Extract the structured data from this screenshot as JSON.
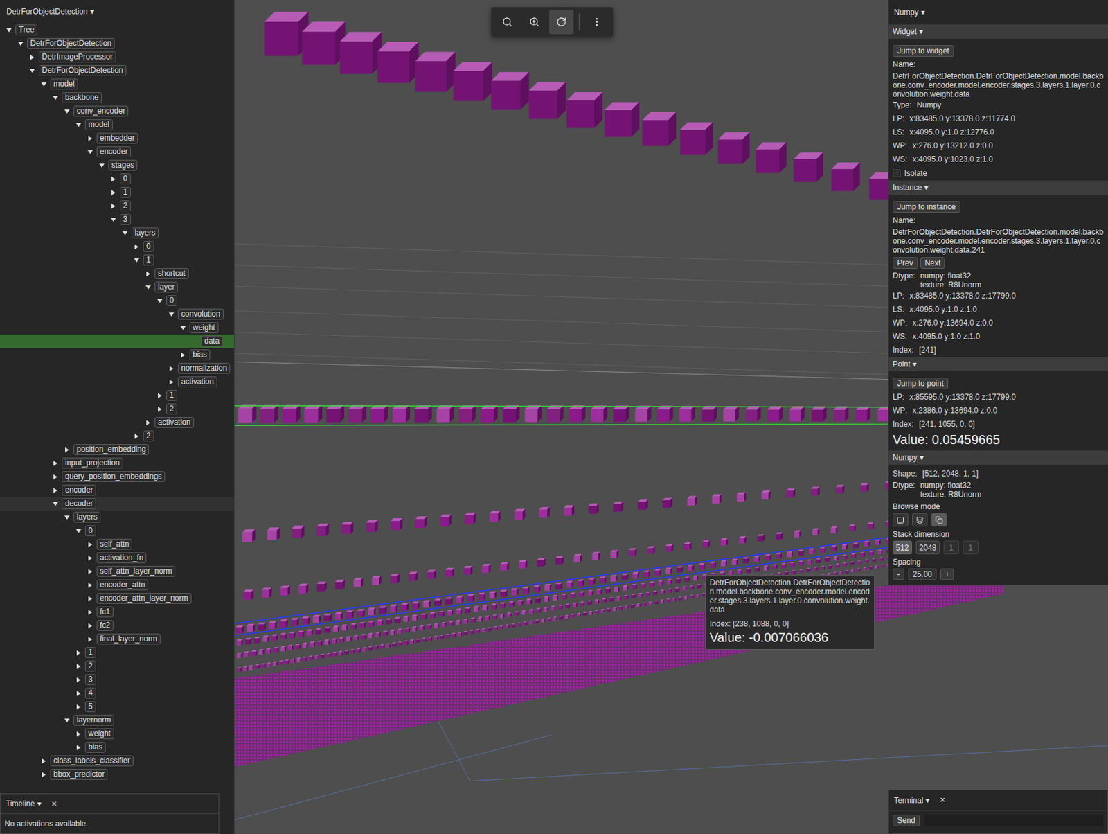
{
  "tree_panel": {
    "title": "DetrForObjectDetection",
    "glyph": "▾"
  },
  "tree": [
    {
      "label": "Tree",
      "depth": 0,
      "expanded": true,
      "leaf": false,
      "selected": false,
      "hovered": false
    },
    {
      "label": "DetrForObjectDetection",
      "depth": 1,
      "expanded": true,
      "leaf": false,
      "selected": false,
      "hovered": false
    },
    {
      "label": "DetrImageProcessor",
      "depth": 2,
      "expanded": false,
      "leaf": false,
      "selected": false,
      "hovered": false
    },
    {
      "label": "DetrForObjectDetection",
      "depth": 2,
      "expanded": true,
      "leaf": false,
      "selected": false,
      "hovered": false
    },
    {
      "label": "model",
      "depth": 3,
      "expanded": true,
      "leaf": false,
      "selected": false,
      "hovered": false
    },
    {
      "label": "backbone",
      "depth": 4,
      "expanded": true,
      "leaf": false,
      "selected": false,
      "hovered": false
    },
    {
      "label": "conv_encoder",
      "depth": 5,
      "expanded": true,
      "leaf": false,
      "selected": false,
      "hovered": false
    },
    {
      "label": "model",
      "depth": 6,
      "expanded": true,
      "leaf": false,
      "selected": false,
      "hovered": false
    },
    {
      "label": "embedder",
      "depth": 7,
      "expanded": false,
      "leaf": false,
      "selected": false,
      "hovered": false
    },
    {
      "label": "encoder",
      "depth": 7,
      "expanded": true,
      "leaf": false,
      "selected": false,
      "hovered": false
    },
    {
      "label": "stages",
      "depth": 8,
      "expanded": true,
      "leaf": false,
      "selected": false,
      "hovered": false
    },
    {
      "label": "0",
      "depth": 9,
      "expanded": false,
      "leaf": false,
      "selected": false,
      "hovered": false
    },
    {
      "label": "1",
      "depth": 9,
      "expanded": false,
      "leaf": false,
      "selected": false,
      "hovered": false
    },
    {
      "label": "2",
      "depth": 9,
      "expanded": false,
      "leaf": false,
      "selected": false,
      "hovered": false
    },
    {
      "label": "3",
      "depth": 9,
      "expanded": true,
      "leaf": false,
      "selected": false,
      "hovered": false
    },
    {
      "label": "layers",
      "depth": 10,
      "expanded": true,
      "leaf": false,
      "selected": false,
      "hovered": false
    },
    {
      "label": "0",
      "depth": 11,
      "expanded": false,
      "leaf": false,
      "selected": false,
      "hovered": false
    },
    {
      "label": "1",
      "depth": 11,
      "expanded": true,
      "leaf": false,
      "selected": false,
      "hovered": false
    },
    {
      "label": "shortcut",
      "depth": 12,
      "expanded": false,
      "leaf": false,
      "selected": false,
      "hovered": false
    },
    {
      "label": "layer",
      "depth": 12,
      "expanded": true,
      "leaf": false,
      "selected": false,
      "hovered": false
    },
    {
      "label": "0",
      "depth": 13,
      "expanded": true,
      "leaf": false,
      "selected": false,
      "hovered": false
    },
    {
      "label": "convolution",
      "depth": 14,
      "expanded": true,
      "leaf": false,
      "selected": false,
      "hovered": false
    },
    {
      "label": "weight",
      "depth": 15,
      "expanded": true,
      "leaf": false,
      "selected": false,
      "hovered": false
    },
    {
      "label": "data",
      "depth": 16,
      "expanded": false,
      "leaf": true,
      "selected": true,
      "hovered": false
    },
    {
      "label": "bias",
      "depth": 15,
      "expanded": false,
      "leaf": false,
      "selected": false,
      "hovered": false
    },
    {
      "label": "normalization",
      "depth": 14,
      "expanded": false,
      "leaf": false,
      "selected": false,
      "hovered": false
    },
    {
      "label": "activation",
      "depth": 14,
      "expanded": false,
      "leaf": false,
      "selected": false,
      "hovered": false
    },
    {
      "label": "1",
      "depth": 13,
      "expanded": false,
      "leaf": false,
      "selected": false,
      "hovered": false
    },
    {
      "label": "2",
      "depth": 13,
      "expanded": false,
      "leaf": false,
      "selected": false,
      "hovered": false
    },
    {
      "label": "activation",
      "depth": 12,
      "expanded": false,
      "leaf": false,
      "selected": false,
      "hovered": false
    },
    {
      "label": "2",
      "depth": 11,
      "expanded": false,
      "leaf": false,
      "selected": false,
      "hovered": false
    },
    {
      "label": "position_embedding",
      "depth": 5,
      "expanded": false,
      "leaf": false,
      "selected": false,
      "hovered": false
    },
    {
      "label": "input_projection",
      "depth": 4,
      "expanded": false,
      "leaf": false,
      "selected": false,
      "hovered": false
    },
    {
      "label": "query_position_embeddings",
      "depth": 4,
      "expanded": false,
      "leaf": false,
      "selected": false,
      "hovered": false
    },
    {
      "label": "encoder",
      "depth": 4,
      "expanded": false,
      "leaf": false,
      "selected": false,
      "hovered": false
    },
    {
      "label": "decoder",
      "depth": 4,
      "expanded": true,
      "leaf": false,
      "selected": false,
      "hovered": true
    },
    {
      "label": "layers",
      "depth": 5,
      "expanded": true,
      "leaf": false,
      "selected": false,
      "hovered": false
    },
    {
      "label": "0",
      "depth": 6,
      "expanded": true,
      "leaf": false,
      "selected": false,
      "hovered": false
    },
    {
      "label": "self_attn",
      "depth": 7,
      "expanded": false,
      "leaf": false,
      "selected": false,
      "hovered": false
    },
    {
      "label": "activation_fn",
      "depth": 7,
      "expanded": false,
      "leaf": false,
      "selected": false,
      "hovered": false
    },
    {
      "label": "self_attn_layer_norm",
      "depth": 7,
      "expanded": false,
      "leaf": false,
      "selected": false,
      "hovered": false
    },
    {
      "label": "encoder_attn",
      "depth": 7,
      "expanded": false,
      "leaf": false,
      "selected": false,
      "hovered": false
    },
    {
      "label": "encoder_attn_layer_norm",
      "depth": 7,
      "expanded": false,
      "leaf": false,
      "selected": false,
      "hovered": false
    },
    {
      "label": "fc1",
      "depth": 7,
      "expanded": false,
      "leaf": false,
      "selected": false,
      "hovered": false
    },
    {
      "label": "fc2",
      "depth": 7,
      "expanded": false,
      "leaf": false,
      "selected": false,
      "hovered": false
    },
    {
      "label": "final_layer_norm",
      "depth": 7,
      "expanded": false,
      "leaf": false,
      "selected": false,
      "hovered": false
    },
    {
      "label": "1",
      "depth": 6,
      "expanded": false,
      "leaf": false,
      "selected": false,
      "hovered": false
    },
    {
      "label": "2",
      "depth": 6,
      "expanded": false,
      "leaf": false,
      "selected": false,
      "hovered": false
    },
    {
      "label": "3",
      "depth": 6,
      "expanded": false,
      "leaf": false,
      "selected": false,
      "hovered": false
    },
    {
      "label": "4",
      "depth": 6,
      "expanded": false,
      "leaf": false,
      "selected": false,
      "hovered": false
    },
    {
      "label": "5",
      "depth": 6,
      "expanded": false,
      "leaf": false,
      "selected": false,
      "hovered": false
    },
    {
      "label": "layernorm",
      "depth": 5,
      "expanded": true,
      "leaf": false,
      "selected": false,
      "hovered": false
    },
    {
      "label": "weight",
      "depth": 6,
      "expanded": false,
      "leaf": false,
      "selected": false,
      "hovered": false
    },
    {
      "label": "bias",
      "depth": 6,
      "expanded": false,
      "leaf": false,
      "selected": false,
      "hovered": false
    },
    {
      "label": "class_labels_classifier",
      "depth": 3,
      "expanded": false,
      "leaf": false,
      "selected": false,
      "hovered": false
    },
    {
      "label": "bbox_predictor",
      "depth": 3,
      "expanded": false,
      "leaf": false,
      "selected": false,
      "hovered": false
    }
  ],
  "timeline": {
    "title": "Timeline",
    "glyph": "▾",
    "close": "×",
    "message": "No activations available."
  },
  "toolbar": [
    {
      "selected": false
    },
    {
      "selected": false
    },
    {
      "selected": true
    },
    {
      "selected": false
    }
  ],
  "inspector": {
    "title": "Numpy",
    "glyph": "▾",
    "widget": {
      "header": "Widget",
      "jump": "Jump to widget",
      "name_label": "Name:",
      "name": "DetrForObjectDetection.DetrForObjectDetection.model.backbone.conv_encoder.model.encoder.stages.3.layers.1.layer.0.convolution.weight.data",
      "fields": [
        {
          "label": "Type:",
          "value": "Numpy"
        },
        {
          "label": "LP:",
          "value": "x:83485.0 y:13378.0 z:11774.0"
        },
        {
          "label": "LS:",
          "value": "x:4095.0 y:1.0 z:12776.0"
        },
        {
          "label": "WP:",
          "value": "x:276.0 y:13212.0 z:0.0"
        },
        {
          "label": "WS:",
          "value": "x:4095.0 y:1023.0 z:1.0"
        }
      ],
      "isolate": {
        "label": "Isolate",
        "checked": false
      }
    },
    "instance": {
      "header": "Instance",
      "jump": "Jump to instance",
      "name_label": "Name:",
      "name": "DetrForObjectDetection.DetrForObjectDetection.model.backbone.conv_encoder.model.encoder.stages.3.layers.1.layer.0.convolution.weight.data.241",
      "prev": "Prev",
      "next": "Next",
      "dtype_label": "Dtype:",
      "dtype": [
        "numpy: float32",
        "texture: R8Unorm"
      ],
      "fields": [
        {
          "label": "LP:",
          "value": "x:83485.0 y:13378.0 z:17799.0"
        },
        {
          "label": "LS:",
          "value": "x:4095.0 y:1.0 z:1.0"
        },
        {
          "label": "WP:",
          "value": "x:276.0 y:13694.0 z:0.0"
        },
        {
          "label": "WS:",
          "value": "x:4095.0 y:1.0 z:1.0"
        },
        {
          "label": "Index:",
          "value": "[241]"
        }
      ]
    },
    "point": {
      "header": "Point",
      "jump": "Jump to point",
      "fields": [
        {
          "label": "LP:",
          "value": "x:85595.0 y:13378.0 z:17799.0"
        },
        {
          "label": "WP:",
          "value": "x:2386.0 y:13694.0 z:0.0"
        },
        {
          "label": "Index:",
          "value": "[241, 1055, 0, 0]"
        }
      ],
      "value_label": "Value:",
      "value": "0.05459665"
    },
    "numpy": {
      "header": "Numpy",
      "shape_label": "Shape:",
      "shape": "[512, 2048, 1, 1]",
      "dtype_label": "Dtype:",
      "dtype": [
        "numpy: float32",
        "texture: R8Unorm"
      ],
      "browse_label": "Browse mode",
      "browse_modes": [
        {
          "selected": false
        },
        {
          "selected": false
        },
        {
          "selected": true
        }
      ],
      "stack_label": "Stack dimension",
      "stack": [
        {
          "label": "512",
          "selected": true,
          "disabled": false
        },
        {
          "label": "2048",
          "selected": false,
          "disabled": false
        },
        {
          "label": "1",
          "selected": false,
          "disabled": true
        },
        {
          "label": "1",
          "selected": false,
          "disabled": true
        }
      ],
      "spacing_label": "Spacing",
      "minus": "-",
      "spacing": "25.00",
      "plus": "+"
    }
  },
  "tooltip": {
    "name": "DetrForObjectDetection.DetrForObjectDetection.model.backbone.conv_encoder.model.encoder.stages.3.layers.1.layer.0.convolution.weight.data",
    "index_label": "Index:",
    "index": "[238, 1088, 0, 0]",
    "value_label": "Value:",
    "value": "-0.007066036"
  },
  "terminal": {
    "title": "Terminal",
    "glyph": "▾",
    "close": "×",
    "send": "Send",
    "input": ""
  }
}
